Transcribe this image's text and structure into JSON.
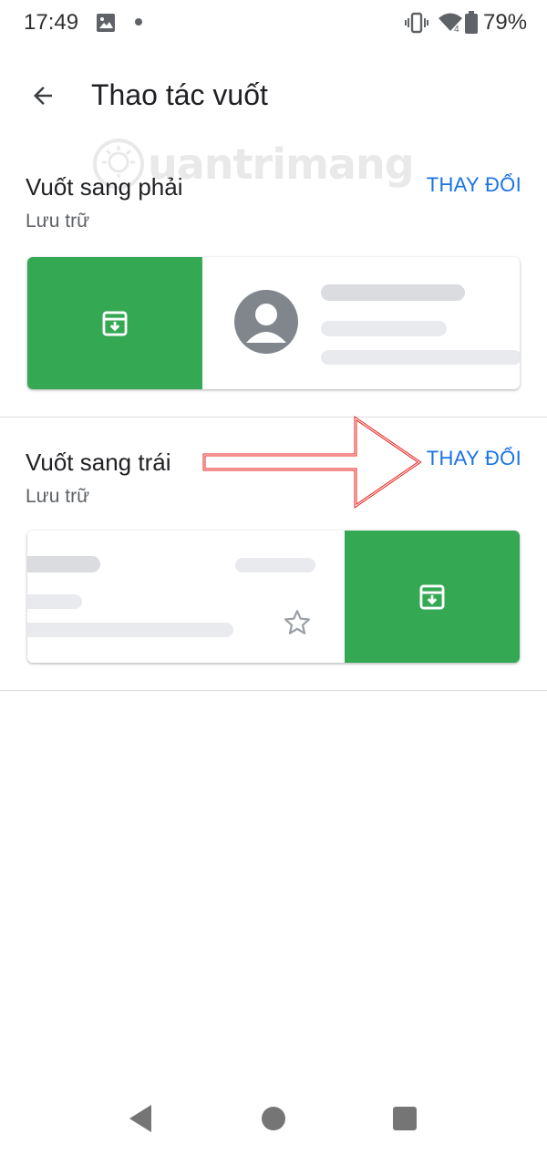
{
  "status_bar": {
    "time": "17:49",
    "battery": "79%",
    "wifi_badge": "4",
    "icons": [
      "image-icon",
      "dot-icon",
      "vibrate-icon",
      "wifi-icon",
      "battery-icon"
    ]
  },
  "header": {
    "title": "Thao tác vuốt",
    "back_icon": "arrow-back-icon"
  },
  "watermark": {
    "text": "uantrimang"
  },
  "swipe_right": {
    "title": "Vuốt sang phải",
    "action": "Lưu trữ",
    "change_label": "THAY ĐỔI",
    "action_icon": "archive-icon"
  },
  "swipe_left": {
    "title": "Vuốt sang trái",
    "action": "Lưu trữ",
    "change_label": "THAY ĐỔI",
    "action_icon": "archive-icon",
    "star_icon": "star-outline-icon"
  },
  "colors": {
    "accent": "#1a73e8",
    "action_green": "#34a853",
    "annotation_red": "#e8211d"
  },
  "nav_bar": {
    "icons": [
      "nav-back-icon",
      "nav-home-icon",
      "nav-recents-icon"
    ]
  }
}
